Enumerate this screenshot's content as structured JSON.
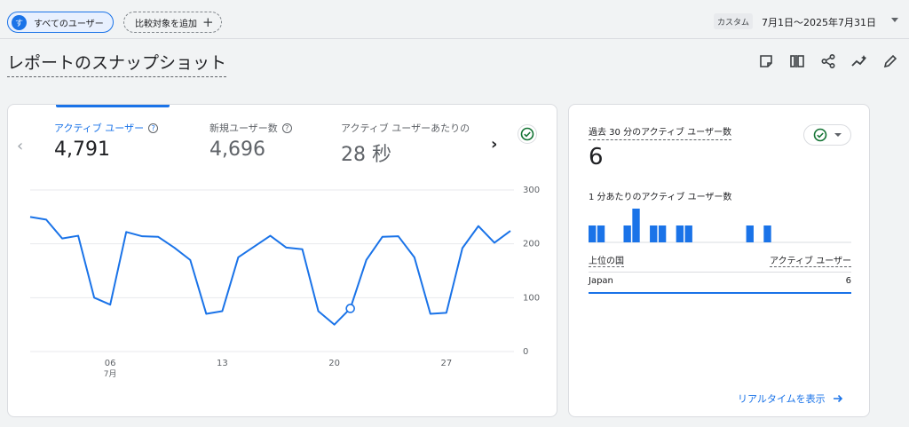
{
  "topbar": {
    "segment": {
      "avatar": "す",
      "label": "すべてのユーザー"
    },
    "add_comparison": {
      "label": "比較対象を追加",
      "icon": "plus-icon"
    },
    "date": {
      "badge": "カスタム",
      "range": "7月1日～2025年7月31日"
    }
  },
  "page": {
    "title": "レポートのスナップショット"
  },
  "actions": [
    "note-icon",
    "compare-columns-icon",
    "share-icon",
    "insights-icon",
    "edit-icon"
  ],
  "main_card": {
    "metrics": [
      {
        "label": "アクティブ ユーザー",
        "value": "4,791"
      },
      {
        "label": "新規ユーザー数",
        "value": "4,696"
      },
      {
        "label": "アクティブ ユーザーあたりの",
        "value": "28 秒"
      }
    ],
    "colors": {
      "line": "#1a73e8",
      "grid": "#e8eaed"
    },
    "chart_data": {
      "type": "line",
      "x": [
        1,
        2,
        3,
        4,
        5,
        6,
        7,
        8,
        9,
        10,
        11,
        12,
        13,
        14,
        15,
        16,
        17,
        18,
        19,
        20,
        21,
        22,
        23,
        24,
        25,
        26,
        27,
        28,
        29,
        30,
        31
      ],
      "series": [
        {
          "values": [
            250,
            245,
            210,
            215,
            100,
            87,
            222,
            214,
            213,
            193,
            170,
            70,
            75,
            175,
            195,
            215,
            193,
            190,
            75,
            50,
            80,
            170,
            213,
            214,
            175,
            70,
            72,
            192,
            233,
            202,
            224
          ]
        }
      ],
      "highlight_index": 20,
      "x_ticks": [
        {
          "x": 6,
          "label": "06",
          "sublabel": "7月"
        },
        {
          "x": 13,
          "label": "13"
        },
        {
          "x": 20,
          "label": "20"
        },
        {
          "x": 27,
          "label": "27"
        }
      ],
      "y_ticks": [
        "0",
        "100",
        "200",
        "300"
      ],
      "ylim": [
        0,
        300
      ],
      "grid": true
    }
  },
  "realtime_card": {
    "title": "過去 30 分のアクティブ ユーザー数",
    "value": "6",
    "subtitle": "1 分あたりのアクティブ ユーザー数",
    "bars": [
      1,
      1,
      0,
      0,
      1,
      2,
      0,
      1,
      1,
      0,
      1,
      1,
      0,
      0,
      0,
      0,
      0,
      0,
      1,
      0,
      1,
      0,
      0,
      0,
      0,
      0,
      0,
      0,
      0,
      0
    ],
    "bar_color": "#1a73e8",
    "table": {
      "col_left": "上位の国",
      "col_right": "アクティブ ユーザー",
      "rows": [
        {
          "country": "Japan",
          "users": "6"
        }
      ]
    },
    "link": "リアルタイムを表示"
  }
}
